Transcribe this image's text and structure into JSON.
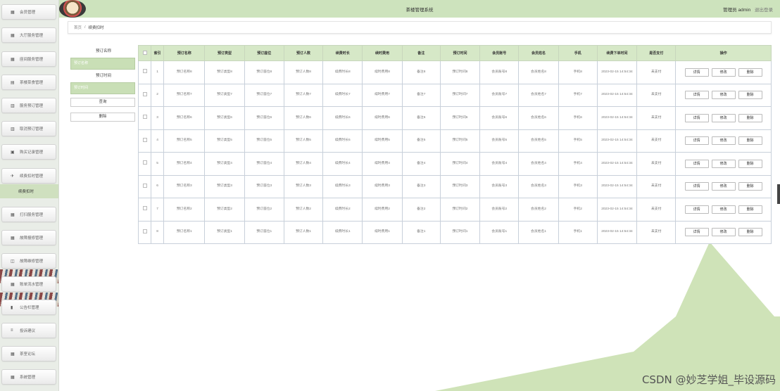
{
  "app": {
    "title": "茶楼管理系统",
    "user_label": "管理员 admin",
    "logout_label": "退出登录"
  },
  "breadcrumb": {
    "home": "首页",
    "separator": "/",
    "current": "续费扣时"
  },
  "sidebar": {
    "items": [
      {
        "label": "会员管理",
        "icon": "grid-icon"
      },
      {
        "label": "大厅服务管理",
        "icon": "grid-icon"
      },
      {
        "label": "座间服务管理",
        "icon": "grid-icon"
      },
      {
        "label": "茶楼菜食管理",
        "icon": "chat-icon"
      },
      {
        "label": "服务预订管理",
        "icon": "book-icon"
      },
      {
        "label": "取消预订管理",
        "icon": "book-icon"
      },
      {
        "label": "购买记录管理",
        "icon": "lock-icon"
      },
      {
        "label": "续费扣时管理",
        "icon": "pin-icon"
      },
      {
        "label": "打扫服务管理",
        "icon": "grid-icon"
      },
      {
        "label": "故障报修管理",
        "icon": "grid-icon"
      },
      {
        "label": "故障维修管理",
        "icon": "chart-icon"
      },
      {
        "label": "账单流水管理",
        "icon": "grid-icon"
      },
      {
        "label": "公告栏管理",
        "icon": "bar-icon"
      },
      {
        "label": "投诉建议",
        "icon": "list-icon"
      },
      {
        "label": "茶室论坛",
        "icon": "grid-icon"
      },
      {
        "label": "系统管理",
        "icon": "grid-icon"
      }
    ],
    "active_sub": "续费扣时"
  },
  "search": {
    "field1_label": "预订名称",
    "field1_placeholder": "预订名称",
    "field2_label": "预订时间",
    "field2_placeholder": "预订时间",
    "query_label": "查询",
    "delete_label": "删除"
  },
  "table": {
    "headers": [
      "索引",
      "预订名称",
      "预订类型",
      "预订座位",
      "预订人数",
      "续费时长",
      "续时费用",
      "备注",
      "预订时间",
      "会员账号",
      "会员姓名",
      "手机",
      "续费下单时间",
      "是否支付",
      "操作"
    ],
    "rows": [
      {
        "idx": "1",
        "name": "预订名称8",
        "type": "预订类型8",
        "seat": "预订座位8",
        "people": "预订人数8",
        "duration": "续费时长8",
        "fee": "续时费用8",
        "note": "备注8",
        "time": "预订时间8",
        "account": "会员账号8",
        "member": "会员姓名8",
        "phone": "手机8",
        "order_time": "2023-02-15 14:54:34",
        "paid": "未支付"
      },
      {
        "idx": "2",
        "name": "预订名称7",
        "type": "预订类型7",
        "seat": "预订座位7",
        "people": "预订人数7",
        "duration": "续费时长7",
        "fee": "续时费用7",
        "note": "备注7",
        "time": "预订时间7",
        "account": "会员账号7",
        "member": "会员姓名7",
        "phone": "手机7",
        "order_time": "2023-02-15 14:54:34",
        "paid": "未支付"
      },
      {
        "idx": "3",
        "name": "预订名称6",
        "type": "预订类型6",
        "seat": "预订座位6",
        "people": "预订人数6",
        "duration": "续费时长6",
        "fee": "续时费用6",
        "note": "备注6",
        "time": "预订时间6",
        "account": "会员账号6",
        "member": "会员姓名6",
        "phone": "手机6",
        "order_time": "2023-02-15 14:54:34",
        "paid": "未支付"
      },
      {
        "idx": "4",
        "name": "预订名称5",
        "type": "预订类型5",
        "seat": "预订座位5",
        "people": "预订人数5",
        "duration": "续费时长5",
        "fee": "续时费用5",
        "note": "备注5",
        "time": "预订时间5",
        "account": "会员账号5",
        "member": "会员姓名5",
        "phone": "手机5",
        "order_time": "2023-02-15 14:54:34",
        "paid": "未支付"
      },
      {
        "idx": "5",
        "name": "预订名称4",
        "type": "预订类型4",
        "seat": "预订座位4",
        "people": "预订人数4",
        "duration": "续费时长4",
        "fee": "续时费用4",
        "note": "备注4",
        "time": "预订时间4",
        "account": "会员账号4",
        "member": "会员姓名4",
        "phone": "手机4",
        "order_time": "2023-02-15 14:54:34",
        "paid": "未支付"
      },
      {
        "idx": "6",
        "name": "预订名称3",
        "type": "预订类型3",
        "seat": "预订座位3",
        "people": "预订人数3",
        "duration": "续费时长3",
        "fee": "续时费用3",
        "note": "备注3",
        "time": "预订时间3",
        "account": "会员账号3",
        "member": "会员姓名3",
        "phone": "手机3",
        "order_time": "2023-02-15 14:54:34",
        "paid": "未支付"
      },
      {
        "idx": "7",
        "name": "预订名称2",
        "type": "预订类型2",
        "seat": "预订座位2",
        "people": "预订人数2",
        "duration": "续费时长2",
        "fee": "续时费用2",
        "note": "备注2",
        "time": "预订时间2",
        "account": "会员账号2",
        "member": "会员姓名2",
        "phone": "手机2",
        "order_time": "2023-02-15 14:54:34",
        "paid": "未支付"
      },
      {
        "idx": "8",
        "name": "预订名称1",
        "type": "预订类型1",
        "seat": "预订座位1",
        "people": "预订人数1",
        "duration": "续费时长1",
        "fee": "续时费用1",
        "note": "备注1",
        "time": "预订时间1",
        "account": "会员账号1",
        "member": "会员姓名1",
        "phone": "手机1",
        "order_time": "2023-02-15 14:54:34",
        "paid": "未支付"
      }
    ],
    "actions": [
      "详情",
      "修改",
      "删除"
    ]
  },
  "watermark": "CSDN @妙芝学姐_毕设源码",
  "colors": {
    "accent": "#cde3bd",
    "header_bg": "#d6e8c7",
    "deco_green": "#cfe3b8"
  }
}
